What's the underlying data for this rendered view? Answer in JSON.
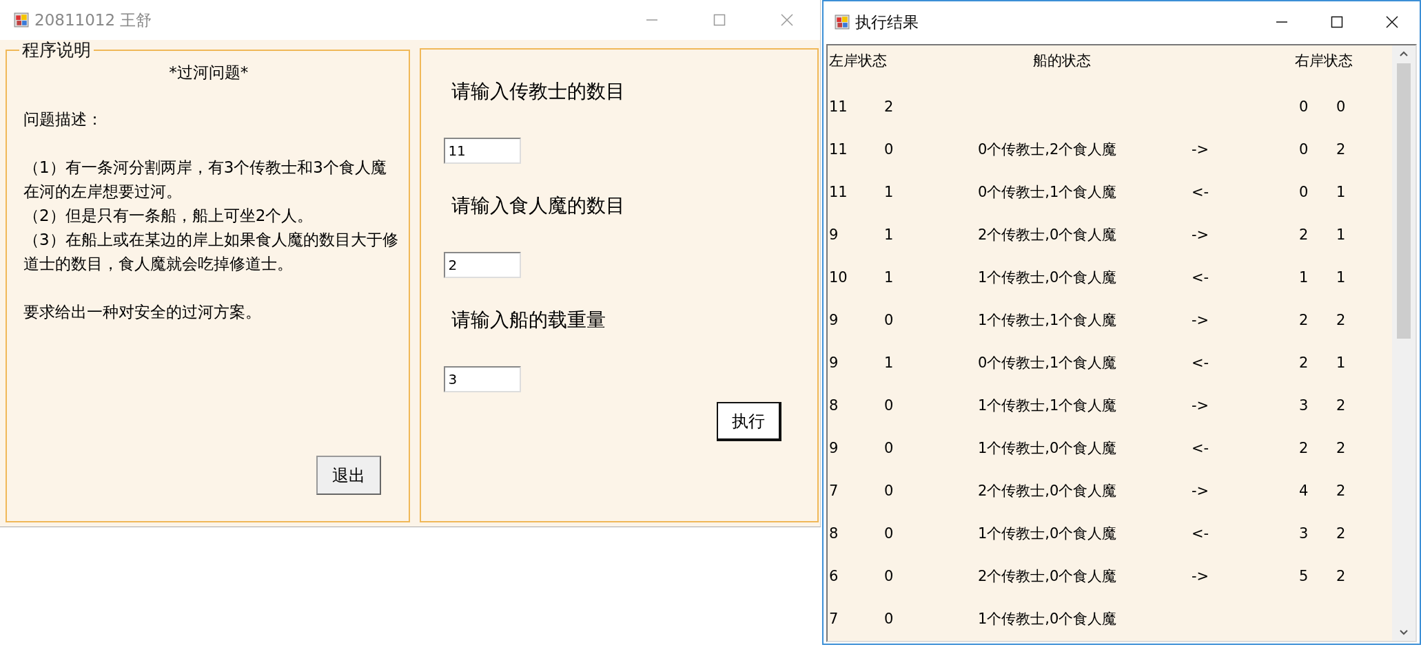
{
  "main_window": {
    "title": "20811012 王舒",
    "description_group": {
      "title": "程序说明",
      "heading": "*过河问题*",
      "blocks": [
        {
          "kind": "section",
          "text": "问题描述："
        },
        {
          "kind": "section",
          "text": "（1）有一条河分割两岸，有3个传教士和3个食人魔在河的左岸想要过河。"
        },
        {
          "kind": "item",
          "text": "（2）但是只有一条船，船上可坐2个人。"
        },
        {
          "kind": "item",
          "text": "（3）在船上或在某边的岸上如果食人魔的数目大于修道士的数目，食人魔就会吃掉修道士。"
        },
        {
          "kind": "section",
          "text": "要求给出一种对安全的过河方案。"
        }
      ],
      "quit_button": "退出"
    },
    "input_group": {
      "fields": [
        {
          "label": "请输入传教士的数目",
          "value": "11"
        },
        {
          "label": "请输入食人魔的数目",
          "value": "2"
        },
        {
          "label": "请输入船的载重量",
          "value": "3"
        }
      ],
      "run_button": "执行"
    }
  },
  "result_window": {
    "title": "执行结果",
    "headers": {
      "left": "左岸状态",
      "boat": "船的状态",
      "right": "右岸状态"
    },
    "rows": [
      {
        "left_m": "11",
        "left_c": "2",
        "right_m": "0",
        "right_c": "0"
      },
      {
        "left_m": "11",
        "left_c": "0",
        "boat": "0个传教士,2个食人魔",
        "direction": "->",
        "right_m": "0",
        "right_c": "2"
      },
      {
        "left_m": "11",
        "left_c": "1",
        "boat": "0个传教士,1个食人魔",
        "direction": "<-",
        "right_m": "0",
        "right_c": "1"
      },
      {
        "left_m": "9",
        "left_c": "1",
        "boat": "2个传教士,0个食人魔",
        "direction": "->",
        "right_m": "2",
        "right_c": "1"
      },
      {
        "left_m": "10",
        "left_c": "1",
        "boat": "1个传教士,0个食人魔",
        "direction": "<-",
        "right_m": "1",
        "right_c": "1"
      },
      {
        "left_m": "9",
        "left_c": "0",
        "boat": "1个传教士,1个食人魔",
        "direction": "->",
        "right_m": "2",
        "right_c": "2"
      },
      {
        "left_m": "9",
        "left_c": "1",
        "boat": "0个传教士,1个食人魔",
        "direction": "<-",
        "right_m": "2",
        "right_c": "1"
      },
      {
        "left_m": "8",
        "left_c": "0",
        "boat": "1个传教士,1个食人魔",
        "direction": "->",
        "right_m": "3",
        "right_c": "2"
      },
      {
        "left_m": "9",
        "left_c": "0",
        "boat": "1个传教士,0个食人魔",
        "direction": "<-",
        "right_m": "2",
        "right_c": "2"
      },
      {
        "left_m": "7",
        "left_c": "0",
        "boat": "2个传教士,0个食人魔",
        "direction": "->",
        "right_m": "4",
        "right_c": "2"
      },
      {
        "left_m": "8",
        "left_c": "0",
        "boat": "1个传教士,0个食人魔",
        "direction": "<-",
        "right_m": "3",
        "right_c": "2"
      },
      {
        "left_m": "6",
        "left_c": "0",
        "boat": "2个传教士,0个食人魔",
        "direction": "->",
        "right_m": "5",
        "right_c": "2"
      },
      {
        "left_m": "7",
        "left_c": "0",
        "boat": "1个传教士,0个食人魔"
      }
    ]
  }
}
